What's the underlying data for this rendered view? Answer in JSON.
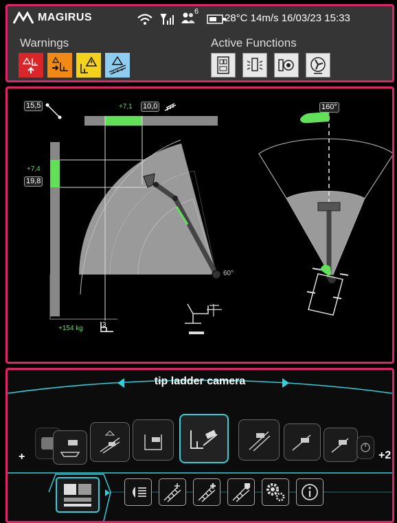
{
  "status_bar": {
    "brand": "MAGIRUS",
    "people_count": "6",
    "status_text": "28°C 14m/s 16/03/23 15:33"
  },
  "warnings": {
    "title": "Warnings",
    "items": [
      {
        "name": "outrigger-warning-icon",
        "color": "#d8262b"
      },
      {
        "name": "outrigger-retract-icon",
        "color": "#f08a14"
      },
      {
        "name": "basket-warning-icon",
        "color": "#f2d21b"
      },
      {
        "name": "ladder-warning-icon",
        "color": "#8ecdf0"
      }
    ]
  },
  "active_functions": {
    "title": "Active Functions",
    "items": [
      "control-panel-icon",
      "warning-lights-icon",
      "generator-icon",
      "fan-icon"
    ]
  },
  "side_view": {
    "vertical_length": "15,5",
    "extension_delta": "+7,1",
    "extension": "10,0",
    "height_delta": "+7,4",
    "height": "19,8",
    "load": "+154 kg",
    "elevation_angle": "60°"
  },
  "top_view": {
    "rotation_angle": "160°"
  },
  "camera": {
    "label": "tip ladder camera",
    "more_left": "+",
    "more_right": "+2"
  },
  "menu": {
    "buttons": [
      "light-icon",
      "ladder-add-icon",
      "ladder-plus-icon",
      "ladder-shield-icon",
      "settings-icon",
      "info-icon"
    ]
  },
  "colors": {
    "accent": "#2fd0dc",
    "highlight": "#e0246b",
    "indicator": "#62e05a"
  }
}
